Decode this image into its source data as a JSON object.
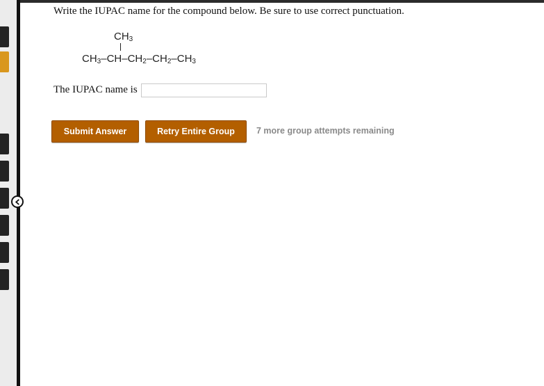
{
  "question": {
    "prompt": "Write the IUPAC name for the compound below. Be sure to use correct punctuation."
  },
  "structure": {
    "branch_group": "CH",
    "branch_sub": "3",
    "chain": [
      {
        "text": "CH",
        "sub": "3"
      },
      {
        "text": "–CH–CH",
        "sub": "2"
      },
      {
        "text": "–CH",
        "sub": "2"
      },
      {
        "text": "–CH",
        "sub": "3"
      }
    ]
  },
  "answer": {
    "label": "The IUPAC name is",
    "value": "",
    "placeholder": ""
  },
  "actions": {
    "submit_label": "Submit Answer",
    "retry_label": "Retry Entire Group",
    "attempts_text": "7 more group attempts remaining"
  },
  "colors": {
    "button": "#b35f00",
    "active_tab": "#d9971e",
    "rail": "#111111"
  },
  "icons": {
    "collapse": "chevron-left-icon"
  }
}
